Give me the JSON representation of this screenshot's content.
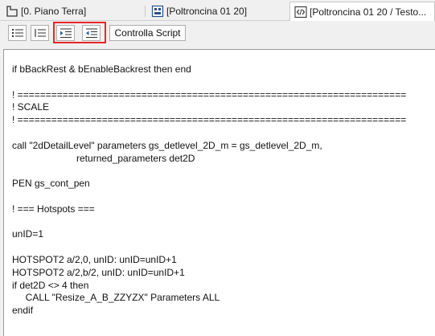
{
  "tabs": [
    {
      "label": "[0. Piano Terra]",
      "icon": "floor-plan-icon"
    },
    {
      "label": "[Poltroncina 01 20]",
      "icon": "object-3d-icon"
    },
    {
      "label": "[Poltroncina 01 20 / Testo...",
      "icon": "script-code-icon"
    }
  ],
  "toolbar": {
    "buttons": [
      {
        "name": "list-view-button",
        "icon": "lines-icon"
      },
      {
        "name": "numbered-view-button",
        "icon": "numbered-lines-icon"
      },
      {
        "name": "indent-button",
        "icon": "indent-icon"
      },
      {
        "name": "outdent-button",
        "icon": "outdent-icon"
      }
    ],
    "check_script_label": "Controlla Script"
  },
  "editor": {
    "lines": [
      "if bBackRest & bEnableBackrest then end",
      "",
      "! =====================================================================",
      "! SCALE",
      "! =====================================================================",
      "",
      "call \"2dDetailLevel\" parameters gs_detlevel_2D_m = gs_detlevel_2D_m,",
      "                        returned_parameters det2D",
      "",
      "PEN gs_cont_pen",
      "",
      "! === Hotspots ===",
      "",
      "unID=1",
      "",
      "HOTSPOT2 a/2,0, unID: unID=unID+1",
      "HOTSPOT2 a/2,b/2, unID: unID=unID+1",
      "if det2D <> 4 then",
      "     CALL \"Resize_A_B_ZZYZX\" Parameters ALL",
      "endif"
    ]
  },
  "colors": {
    "highlight": "#e8262a",
    "accent_blue": "#1f5fb0"
  }
}
